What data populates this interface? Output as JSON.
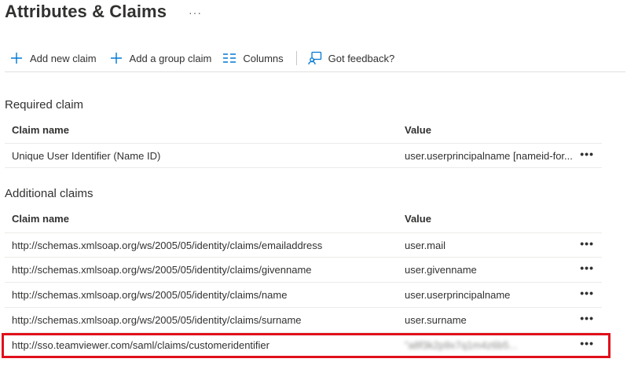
{
  "header": {
    "title": "Attributes & Claims",
    "more": "···"
  },
  "toolbar": {
    "add_new_claim": "Add new claim",
    "add_group_claim": "Add a group claim",
    "columns": "Columns",
    "feedback": "Got feedback?"
  },
  "required": {
    "title": "Required claim",
    "col_name": "Claim name",
    "col_value": "Value",
    "rows": [
      {
        "name": "Unique User Identifier (Name ID)",
        "value": "user.userprincipalname [nameid-for...",
        "more": "•••"
      }
    ]
  },
  "additional": {
    "title": "Additional claims",
    "col_name": "Claim name",
    "col_value": "Value",
    "rows": [
      {
        "name": "http://schemas.xmlsoap.org/ws/2005/05/identity/claims/emailaddress",
        "value": "user.mail",
        "more": "•••"
      },
      {
        "name": "http://schemas.xmlsoap.org/ws/2005/05/identity/claims/givenname",
        "value": "user.givenname",
        "more": "•••"
      },
      {
        "name": "http://schemas.xmlsoap.org/ws/2005/05/identity/claims/name",
        "value": "user.userprincipalname",
        "more": "•••"
      },
      {
        "name": "http://schemas.xmlsoap.org/ws/2005/05/identity/claims/surname",
        "value": "user.surname",
        "more": "•••"
      },
      {
        "name": "http://sso.teamviewer.com/saml/claims/customeridentifier",
        "value": "\"a8f3k2p9x7q1m4z6b5...",
        "more": "•••"
      }
    ]
  },
  "colors": {
    "accent": "#0078d4",
    "highlight": "#e0101b"
  }
}
